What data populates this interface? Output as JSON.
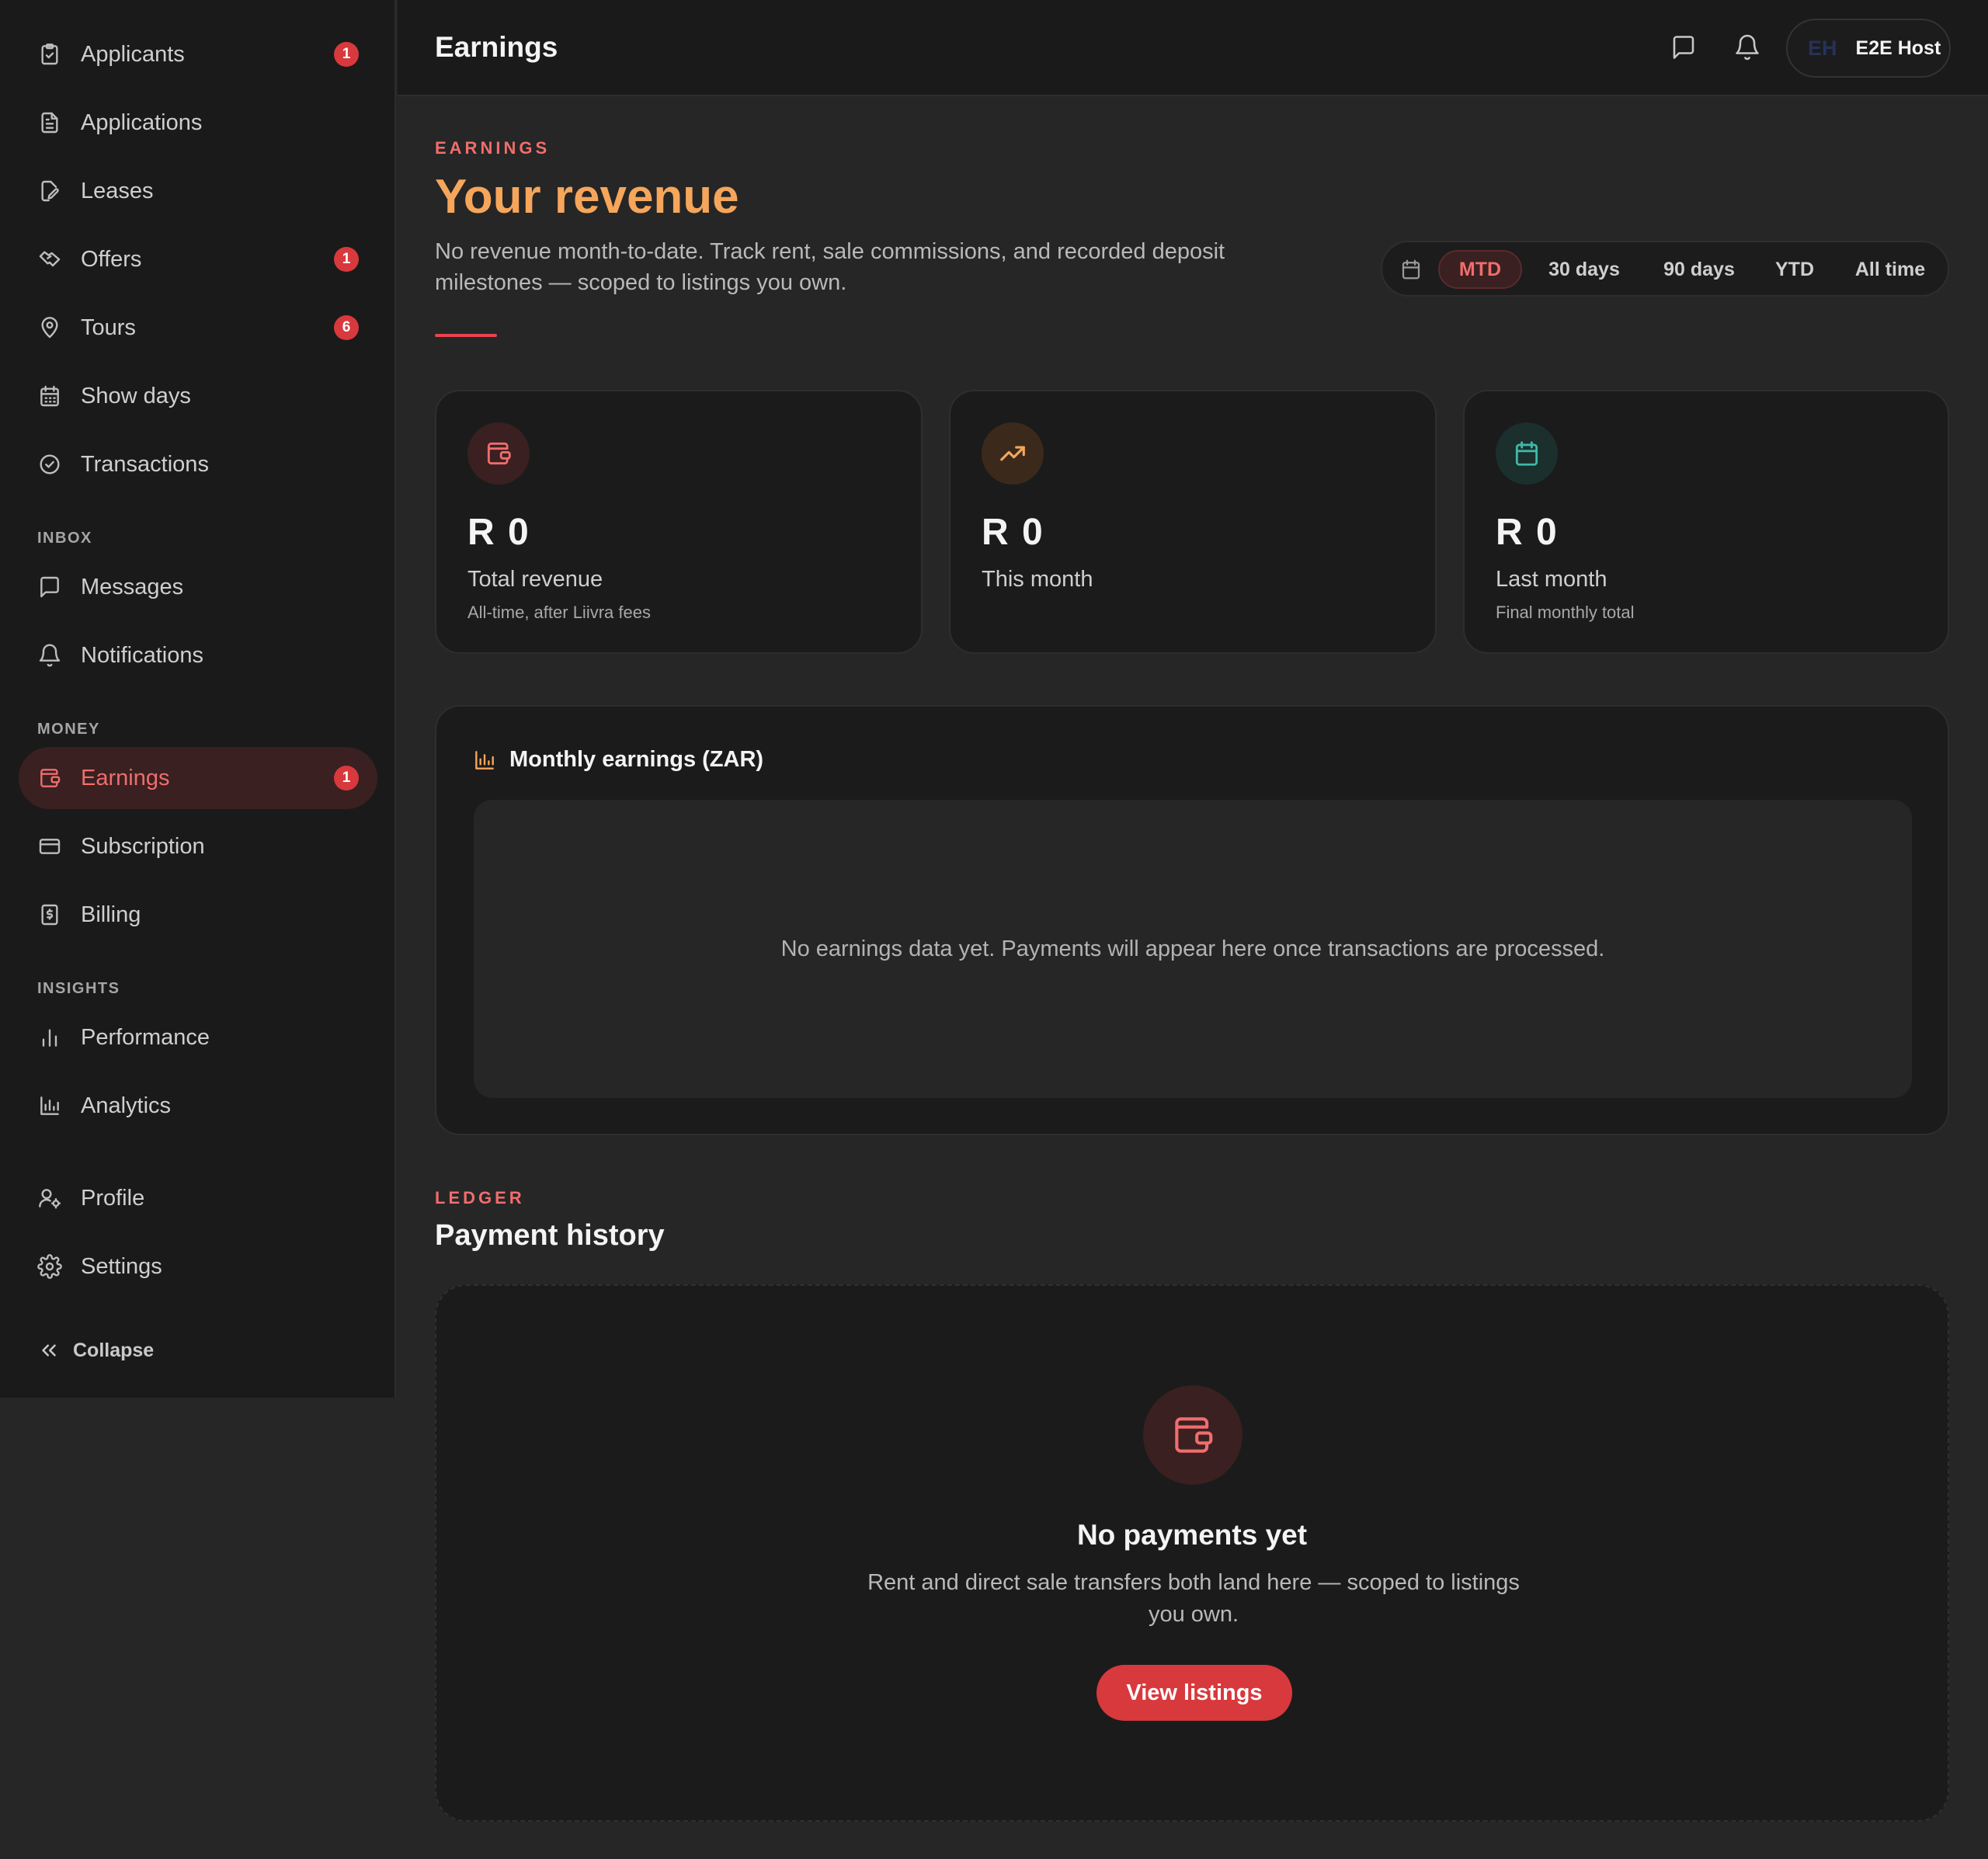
{
  "sidebar": {
    "items": [
      {
        "label": "Applicants",
        "badge": "1",
        "icon": "clipboard-icon"
      },
      {
        "label": "Applications",
        "badge": "",
        "icon": "document-icon"
      },
      {
        "label": "Leases",
        "badge": "",
        "icon": "pen-document-icon"
      },
      {
        "label": "Offers",
        "badge": "1",
        "icon": "handshake-icon"
      },
      {
        "label": "Tours",
        "badge": "6",
        "icon": "map-pin-icon"
      },
      {
        "label": "Show days",
        "badge": "",
        "icon": "calendar-grid-icon"
      },
      {
        "label": "Transactions",
        "badge": "",
        "icon": "check-circle-icon"
      },
      {
        "label": "Messages",
        "badge": "",
        "icon": "message-icon"
      },
      {
        "label": "Notifications",
        "badge": "",
        "icon": "bell-icon"
      },
      {
        "label": "Earnings",
        "badge": "1",
        "icon": "wallet-icon"
      },
      {
        "label": "Subscription",
        "badge": "",
        "icon": "credit-card-icon"
      },
      {
        "label": "Billing",
        "badge": "",
        "icon": "receipt-icon"
      },
      {
        "label": "Performance",
        "badge": "",
        "icon": "bar-chart-icon"
      },
      {
        "label": "Analytics",
        "badge": "",
        "icon": "analytics-chart-icon"
      },
      {
        "label": "Profile",
        "badge": "",
        "icon": "user-gear-icon"
      },
      {
        "label": "Settings",
        "badge": "",
        "icon": "gear-icon"
      }
    ],
    "sections": {
      "inbox": "INBOX",
      "money": "MONEY",
      "insights": "INSIGHTS"
    },
    "collapse_label": "Collapse"
  },
  "topbar": {
    "title": "Earnings",
    "user_initials": "EH",
    "user_name": "E2E Host"
  },
  "header": {
    "eyebrow": "EARNINGS",
    "title": "Your revenue",
    "subtitle": "No revenue month-to-date. Track rent, sale commissions, and recorded deposit milestones — scoped to listings you own."
  },
  "range": {
    "options": [
      "MTD",
      "30 days",
      "90 days",
      "YTD",
      "All time"
    ],
    "selected": "MTD"
  },
  "stats": [
    {
      "value": "R 0",
      "label": "Total revenue",
      "sub": "All-time, after Liivra fees",
      "icon": "wallet-icon",
      "color": "#f06d6d"
    },
    {
      "value": "R 0",
      "label": "This month",
      "sub": "",
      "icon": "trending-up-icon",
      "color": "#f5a65b"
    },
    {
      "value": "R 0",
      "label": "Last month",
      "sub": "Final monthly total",
      "icon": "calendar-icon",
      "color": "#3fb8a8"
    }
  ],
  "chart": {
    "title": "Monthly earnings (ZAR)",
    "empty_text": "No earnings data yet. Payments will appear here once transactions are processed."
  },
  "ledger": {
    "eyebrow": "LEDGER",
    "title": "Payment history",
    "empty_title": "No payments yet",
    "empty_sub": "Rent and direct sale transfers both land here — scoped to listings you own.",
    "button_label": "View listings"
  },
  "colors": {
    "accent": "#d8393d",
    "accent_text": "#f06d6d",
    "orange": "#f5a65b",
    "teal": "#3fb8a8"
  }
}
